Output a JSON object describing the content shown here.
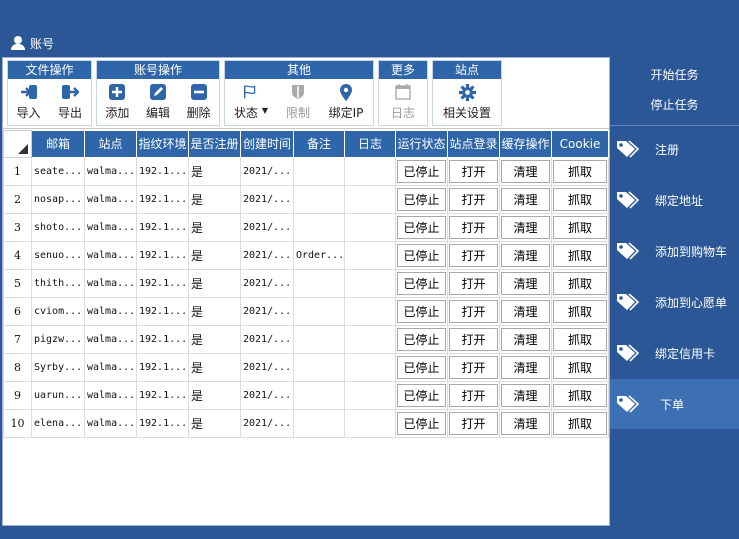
{
  "window": {
    "title": "账号"
  },
  "ribbon": {
    "groups": [
      {
        "title": "文件操作",
        "buttons": [
          {
            "label": "导入",
            "icon": "import-icon"
          },
          {
            "label": "导出",
            "icon": "export-icon"
          }
        ]
      },
      {
        "title": "账号操作",
        "buttons": [
          {
            "label": "添加",
            "icon": "add-icon"
          },
          {
            "label": "编辑",
            "icon": "edit-icon"
          },
          {
            "label": "删除",
            "icon": "delete-icon"
          }
        ]
      },
      {
        "title": "其他",
        "buttons": [
          {
            "label": "状态",
            "icon": "flag-icon"
          },
          {
            "label": "限制",
            "icon": "shield-icon",
            "disabled": true
          },
          {
            "label": "绑定IP",
            "icon": "location-pin-icon"
          }
        ]
      },
      {
        "title": "更多",
        "buttons": [
          {
            "label": "日志",
            "icon": "calendar-icon",
            "disabled": true
          }
        ]
      },
      {
        "title": "站点",
        "buttons": [
          {
            "label": "相关设置",
            "icon": "gear-icon"
          }
        ]
      }
    ]
  },
  "table": {
    "columns": [
      "邮箱",
      "站点",
      "指纹环境",
      "是否注册",
      "创建时间",
      "备注",
      "日志",
      "运行状态",
      "站点登录",
      "缓存操作",
      "Cookie"
    ],
    "rows": [
      {
        "num": "1",
        "email": "seate...",
        "site": "walma...",
        "env": "192.1...",
        "reg": "是",
        "created": "2021/...",
        "note": "",
        "log": "",
        "status": "已停止",
        "login": "打开",
        "cache": "清理",
        "cookie": "抓取"
      },
      {
        "num": "2",
        "email": "nosap...",
        "site": "walma...",
        "env": "192.1...",
        "reg": "是",
        "created": "2021/...",
        "note": "",
        "log": "",
        "status": "已停止",
        "login": "打开",
        "cache": "清理",
        "cookie": "抓取"
      },
      {
        "num": "3",
        "email": "shoto...",
        "site": "walma...",
        "env": "192.1...",
        "reg": "是",
        "created": "2021/...",
        "note": "",
        "log": "",
        "status": "已停止",
        "login": "打开",
        "cache": "清理",
        "cookie": "抓取"
      },
      {
        "num": "4",
        "email": "senuo...",
        "site": "walma...",
        "env": "192.1...",
        "reg": "是",
        "created": "2021/...",
        "note": "Order...",
        "log": "",
        "status": "已停止",
        "login": "打开",
        "cache": "清理",
        "cookie": "抓取"
      },
      {
        "num": "5",
        "email": "thith...",
        "site": "walma...",
        "env": "192.1...",
        "reg": "是",
        "created": "2021/...",
        "note": "",
        "log": "",
        "status": "已停止",
        "login": "打开",
        "cache": "清理",
        "cookie": "抓取"
      },
      {
        "num": "6",
        "email": "cviom...",
        "site": "walma...",
        "env": "192.1...",
        "reg": "是",
        "created": "2021/...",
        "note": "",
        "log": "",
        "status": "已停止",
        "login": "打开",
        "cache": "清理",
        "cookie": "抓取"
      },
      {
        "num": "7",
        "email": "pigzw...",
        "site": "walma...",
        "env": "192.1...",
        "reg": "是",
        "created": "2021/...",
        "note": "",
        "log": "",
        "status": "已停止",
        "login": "打开",
        "cache": "清理",
        "cookie": "抓取"
      },
      {
        "num": "8",
        "email": "Syrby...",
        "site": "walma...",
        "env": "192.1...",
        "reg": "是",
        "created": "2021/...",
        "note": "",
        "log": "",
        "status": "已停止",
        "login": "打开",
        "cache": "清理",
        "cookie": "抓取"
      },
      {
        "num": "9",
        "email": "uarun...",
        "site": "walma...",
        "env": "192.1...",
        "reg": "是",
        "created": "2021/...",
        "note": "",
        "log": "",
        "status": "已停止",
        "login": "打开",
        "cache": "清理",
        "cookie": "抓取"
      },
      {
        "num": "10",
        "email": "elena...",
        "site": "walma...",
        "env": "192.1...",
        "reg": "是",
        "created": "2021/...",
        "note": "",
        "log": "",
        "status": "已停止",
        "login": "打开",
        "cache": "清理",
        "cookie": "抓取"
      }
    ]
  },
  "side": {
    "start_task": "开始任务",
    "stop_task": "停止任务",
    "nav": [
      {
        "label": "注册"
      },
      {
        "label": "绑定地址"
      },
      {
        "label": "添加到购物车"
      },
      {
        "label": "添加到心愿单"
      },
      {
        "label": "绑定信用卡"
      },
      {
        "label": "下单",
        "active": true
      }
    ]
  },
  "colors": {
    "window_bg": "#2b5797",
    "header_blue": "#2f66aa",
    "active_nav": "#3d6fb3",
    "accent_icon": "#2f66aa"
  }
}
